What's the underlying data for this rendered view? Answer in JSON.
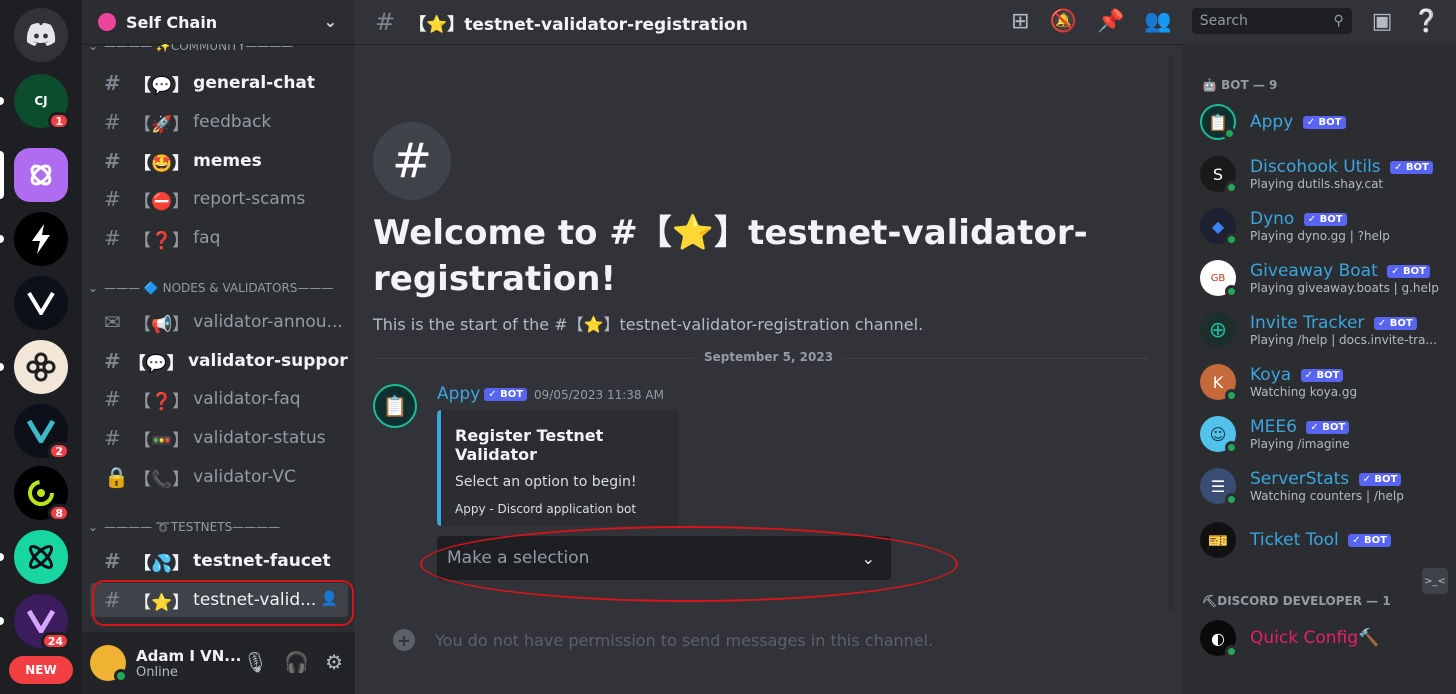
{
  "servers": [
    {
      "name": "Discord",
      "icon": "discord-logo-icon",
      "color": "#313338",
      "badge": ""
    },
    {
      "name": "CJ server",
      "icon": "server-cj-icon",
      "color": "#0b4d2d",
      "badge": "1",
      "initials": "CJ"
    },
    {
      "name": "Self Chain",
      "icon": "selfchain-icon",
      "color": "#b06cf0",
      "badge": ""
    },
    {
      "name": "Lightning server",
      "icon": "lightning-icon",
      "color": "#000000",
      "badge": ""
    },
    {
      "name": "V server",
      "icon": "v-icon",
      "color": "#0d1018",
      "badge": ""
    },
    {
      "name": "Knot server",
      "icon": "knot-icon",
      "color": "#f2e6d8",
      "badge": ""
    },
    {
      "name": "V2 server",
      "icon": "v2-icon",
      "color": "#0d1018",
      "badge": "2"
    },
    {
      "name": "Ring server",
      "icon": "ring-icon",
      "color": "#000000",
      "badge": "8"
    },
    {
      "name": "Atom server",
      "icon": "atom-icon",
      "color": "#18d6a1",
      "badge": ""
    },
    {
      "name": "V3 server",
      "icon": "v3-icon",
      "color": "#3b1d5e",
      "badge": "24"
    }
  ],
  "new_badge": "NEW",
  "guild": {
    "name": "Self Chain"
  },
  "categories": [
    {
      "label": "———— ✨COMMUNITY————"
    },
    {
      "label": "——— 🔷 NODES & VALIDATORS———"
    },
    {
      "label": "———— ➰TESTNETS————"
    }
  ],
  "channels": [
    {
      "emoji": "【💬】",
      "name": "general-chat",
      "unread": true
    },
    {
      "emoji": "【🚀】",
      "name": "feedback",
      "unread": false
    },
    {
      "emoji": "【🤩】",
      "name": "memes",
      "unread": true
    },
    {
      "emoji": "【⛔】",
      "name": "report-scams",
      "unread": false
    },
    {
      "emoji": "【❓】",
      "name": "faq",
      "unread": false
    },
    {
      "emoji": "【📢】",
      "name": "validator-annou...",
      "unread": false
    },
    {
      "emoji": "【💬】",
      "name": "validator-support",
      "unread": true
    },
    {
      "emoji": "【❓】",
      "name": "validator-faq",
      "unread": false
    },
    {
      "emoji": "【🚥】",
      "name": "validator-status",
      "unread": false
    },
    {
      "emoji": "【📞】",
      "name": "validator-VC",
      "unread": false
    },
    {
      "emoji": "【💦】",
      "name": "testnet-faucet",
      "unread": true
    },
    {
      "emoji": "【⭐】",
      "name": "testnet-valid...",
      "unread": false
    }
  ],
  "user": {
    "name": "Adam I VN...",
    "status": "Online"
  },
  "channel_header": {
    "title": "【⭐】testnet-validator-registration",
    "search_placeholder": "Search"
  },
  "welcome": {
    "title": "Welcome to #【⭐】testnet-validator-registration!",
    "subtitle": "This is the start of the #【⭐】testnet-validator-registration channel."
  },
  "date_divider": "September 5, 2023",
  "message": {
    "author": "Appy",
    "bot_tag": "✓ BOT",
    "timestamp": "09/05/2023 11:38 AM",
    "embed_title": "Register Testnet Validator",
    "embed_desc": "Select an option to begin!",
    "embed_footer": "Appy - Discord application bot",
    "select_placeholder": "Make a selection"
  },
  "composer_placeholder": "You do not have permission to send messages in this channel.",
  "member_groups": [
    {
      "label": "🤖 BOT — 9"
    },
    {
      "label": "⛏DISCORD DEVELOPER — 1"
    }
  ],
  "members": [
    {
      "name": "Appy",
      "activity": "",
      "color": "#10302f",
      "bot": true
    },
    {
      "name": "Discohook Utils",
      "activity": "Playing dutils.shay.cat",
      "color": "#1a1a1a",
      "bot": true
    },
    {
      "name": "Dyno",
      "activity": "Playing dyno.gg | ?help",
      "color": "#1d2131",
      "bot": true
    },
    {
      "name": "Giveaway Boat",
      "activity": "Playing giveaway.boats | g.help",
      "color": "#ffffff",
      "bot": true
    },
    {
      "name": "Invite Tracker",
      "activity": "Playing /help | docs.invite-tra...",
      "color": "#1c2f2c",
      "bot": true
    },
    {
      "name": "Koya",
      "activity": "Watching koya.gg",
      "color": "#c46a3b",
      "bot": true
    },
    {
      "name": "MEE6",
      "activity": "Playing /imagine",
      "color": "#53c2ea",
      "bot": true
    },
    {
      "name": "ServerStats",
      "activity": "Watching counters | /help",
      "color": "#3a4e73",
      "bot": true
    },
    {
      "name": "Ticket Tool",
      "activity": "",
      "color": "#111111",
      "bot": true
    },
    {
      "name": "Quick Config",
      "activity": "",
      "color": "#0a0a0a",
      "bot": false,
      "name_suffix": "🔨"
    }
  ]
}
